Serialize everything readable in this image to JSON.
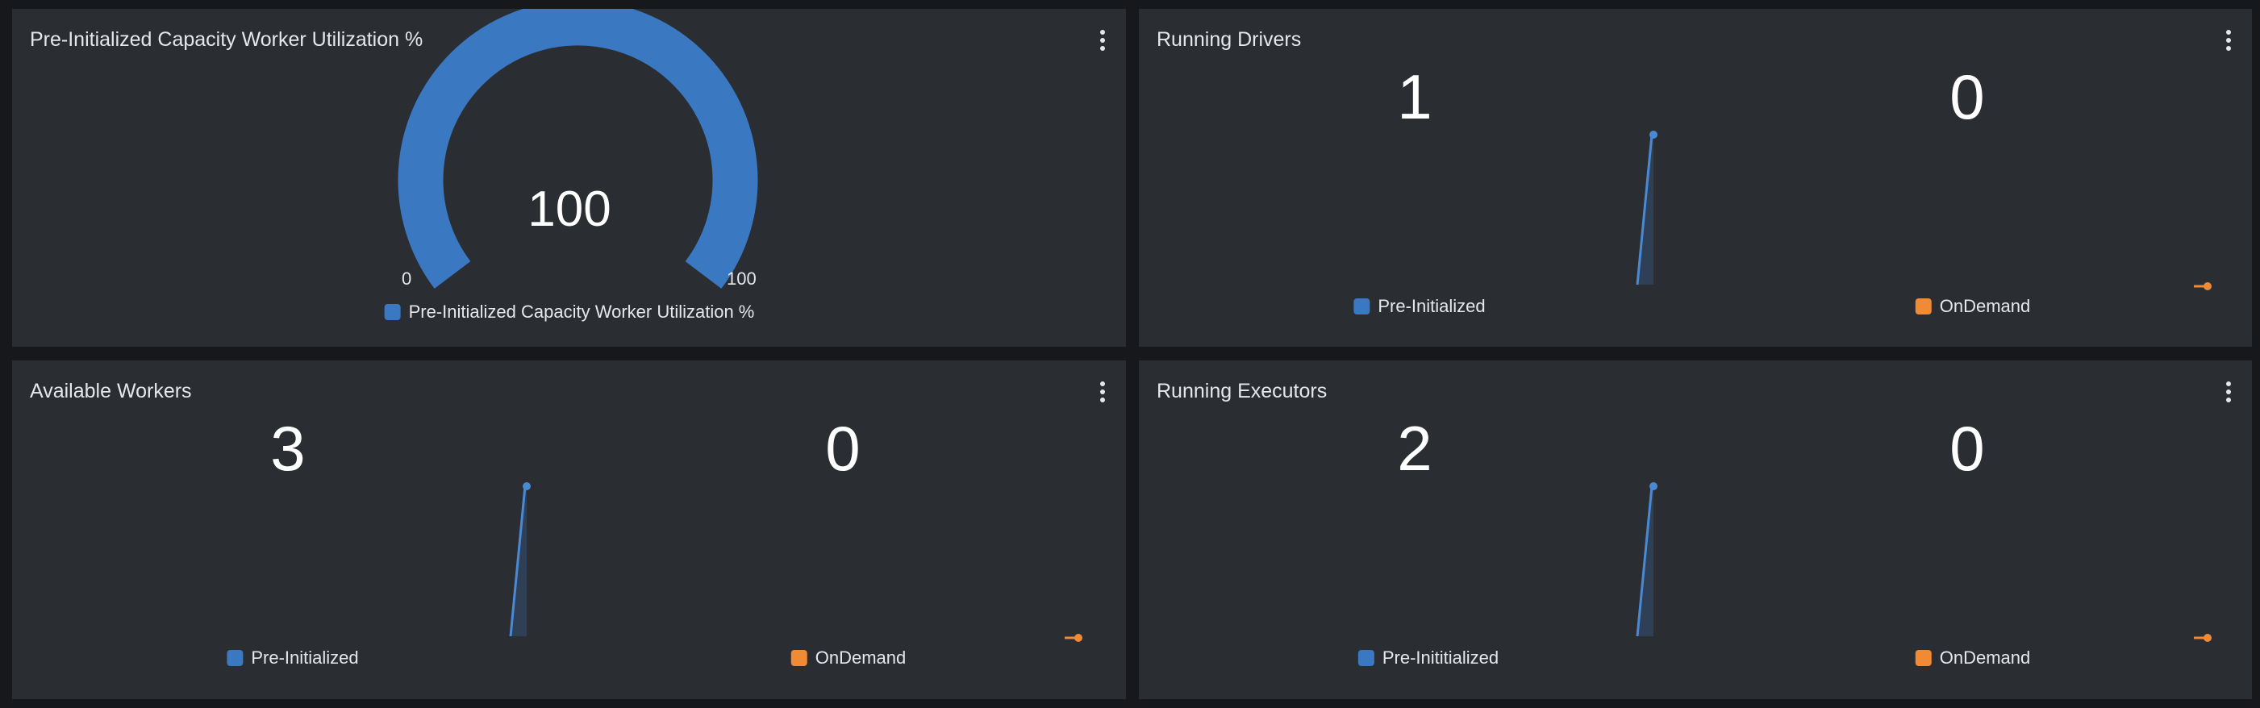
{
  "colors": {
    "background": "#16181c",
    "panel": "#2a2d32",
    "pre_initialized": "#3b78c2",
    "on_demand": "#f08a35"
  },
  "panels": {
    "utilization": {
      "title": "Pre-Initialized Capacity Worker Utilization %",
      "menu_icon": "vertical-ellipsis-icon",
      "gauge": {
        "value": "100",
        "min": "0",
        "max": "100",
        "fill_fraction": 1.0
      },
      "legend": "Pre-Initialized Capacity Worker Utilization %"
    },
    "running_drivers": {
      "title": "Running Drivers",
      "menu_icon": "vertical-ellipsis-icon",
      "pre_initialized_value": "1",
      "on_demand_value": "0",
      "legend_pre": "Pre-Initialized",
      "legend_on": "OnDemand"
    },
    "available_workers": {
      "title": "Available Workers",
      "menu_icon": "vertical-ellipsis-icon",
      "pre_initialized_value": "3",
      "on_demand_value": "0",
      "legend_pre": "Pre-Initialized",
      "legend_on": "OnDemand"
    },
    "running_executors": {
      "title": "Running Executors",
      "menu_icon": "vertical-ellipsis-icon",
      "pre_initialized_value": "2",
      "on_demand_value": "0",
      "legend_pre": "Pre-Inititialized",
      "legend_on": "OnDemand"
    }
  }
}
